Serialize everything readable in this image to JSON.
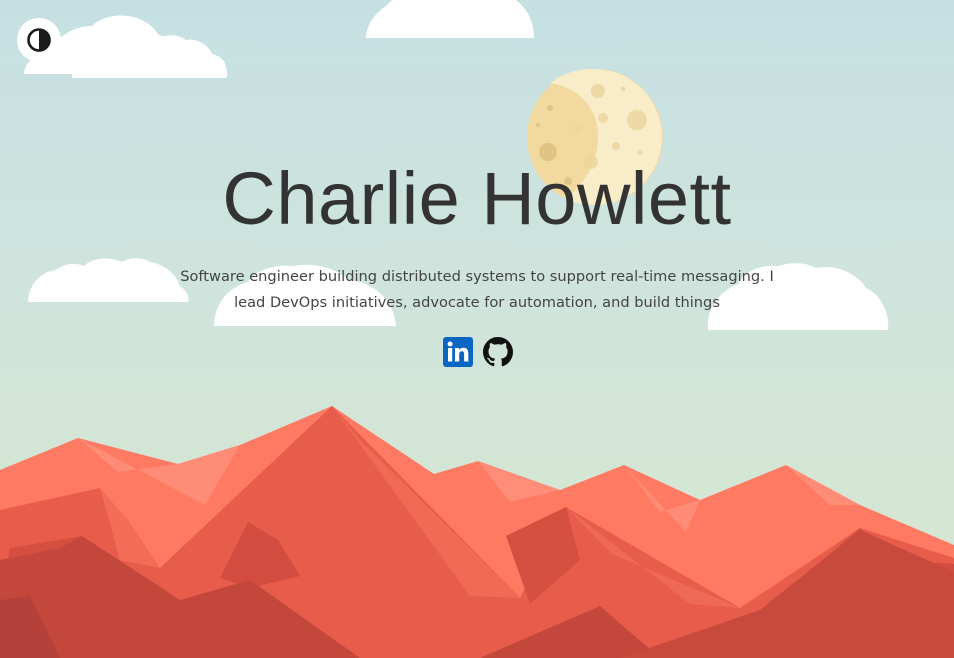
{
  "page": {
    "name": "Charlie Howlett",
    "bio": "Software engineer building distributed systems to support real-time messaging. I lead DevOps initiatives, advocate for automation, and build things"
  },
  "toggle": {
    "icon": "contrast-icon"
  },
  "socials": [
    {
      "icon": "linkedin-icon",
      "color": "#0a66c2"
    },
    {
      "icon": "github-icon",
      "color": "#111111"
    }
  ],
  "colors": {
    "sky_top": "#c6e0e2",
    "sky_bottom": "#d8e7cd",
    "moon": "#f9ecc8",
    "moon_shadow": "#f2d9a0",
    "mountain_light": "#ff7f66",
    "mountain_mid": "#e6594a",
    "mountain_dark": "#c4493d"
  }
}
